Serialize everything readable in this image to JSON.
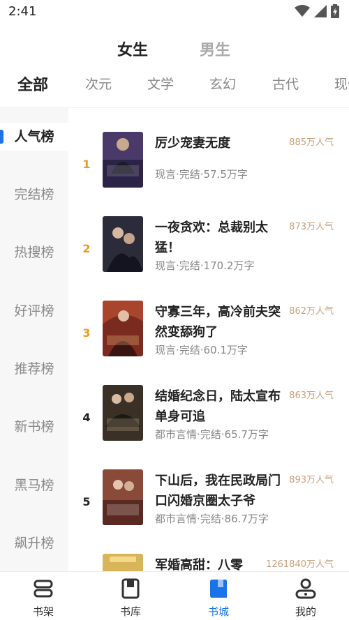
{
  "status_bar": {
    "time": "2:41"
  },
  "gender_tabs": [
    {
      "label": "女生",
      "active": true
    },
    {
      "label": "男生",
      "active": false
    }
  ],
  "category_tabs": [
    {
      "label": "全部",
      "active": true
    },
    {
      "label": "次元"
    },
    {
      "label": "文学"
    },
    {
      "label": "玄幻"
    },
    {
      "label": "古代"
    },
    {
      "label": "现代"
    }
  ],
  "sidebar": {
    "items": [
      {
        "label": "人气榜",
        "active": true
      },
      {
        "label": "完结榜"
      },
      {
        "label": "热搜榜"
      },
      {
        "label": "好评榜"
      },
      {
        "label": "推荐榜"
      },
      {
        "label": "新书榜"
      },
      {
        "label": "黑马榜"
      },
      {
        "label": "飙升榜"
      }
    ]
  },
  "books": [
    {
      "rank": "1",
      "title": "厉少宠妻无度",
      "meta": "现言·完结·57.5万字",
      "popularity": "885万人气",
      "cover_color": "#4a3a6a",
      "cover_text": "厉少宠妻无度"
    },
    {
      "rank": "2",
      "title": "一夜贪欢：总裁别太猛！",
      "meta": "现言·完结·170.2万字",
      "popularity": "873万人气",
      "cover_color": "#2b2b3a",
      "cover_text": ""
    },
    {
      "rank": "3",
      "title": "守寡三年，高冷前夫突然变舔狗了",
      "meta": "现言·完结·60.1万字",
      "popularity": "862万人气",
      "cover_color": "#7a2a1e",
      "cover_text": "高冷前夫变舔狗了"
    },
    {
      "rank": "4",
      "title": "结婚纪念日，陆太宣布单身可追",
      "meta": "都市言情·完结·65.7万字",
      "popularity": "863万人气",
      "cover_color": "#3a3026",
      "cover_text": "陆太宣布单身可追"
    },
    {
      "rank": "5",
      "title": "下山后，我在民政局门口闪婚京圈太子爷",
      "meta": "都市言情·完结·86.7万字",
      "popularity": "893万人气",
      "cover_color": "#8a4a3a",
      "cover_text": "闪婚京圈太子爷"
    },
    {
      "rank": "",
      "title": "军婚高甜：八零",
      "meta": "",
      "popularity": "1261840万人气",
      "cover_color": "#d9b55a",
      "cover_text": ""
    }
  ],
  "bottom_nav": [
    {
      "label": "书架",
      "icon": "bookshelf-icon",
      "active": false
    },
    {
      "label": "书库",
      "icon": "library-icon",
      "active": false
    },
    {
      "label": "书城",
      "icon": "bookstore-icon",
      "active": true
    },
    {
      "label": "我的",
      "icon": "profile-icon",
      "active": false
    }
  ],
  "colors": {
    "accent": "#1a73e8",
    "rank_top": "#f29a1d",
    "popularity": "#c9a07a"
  }
}
